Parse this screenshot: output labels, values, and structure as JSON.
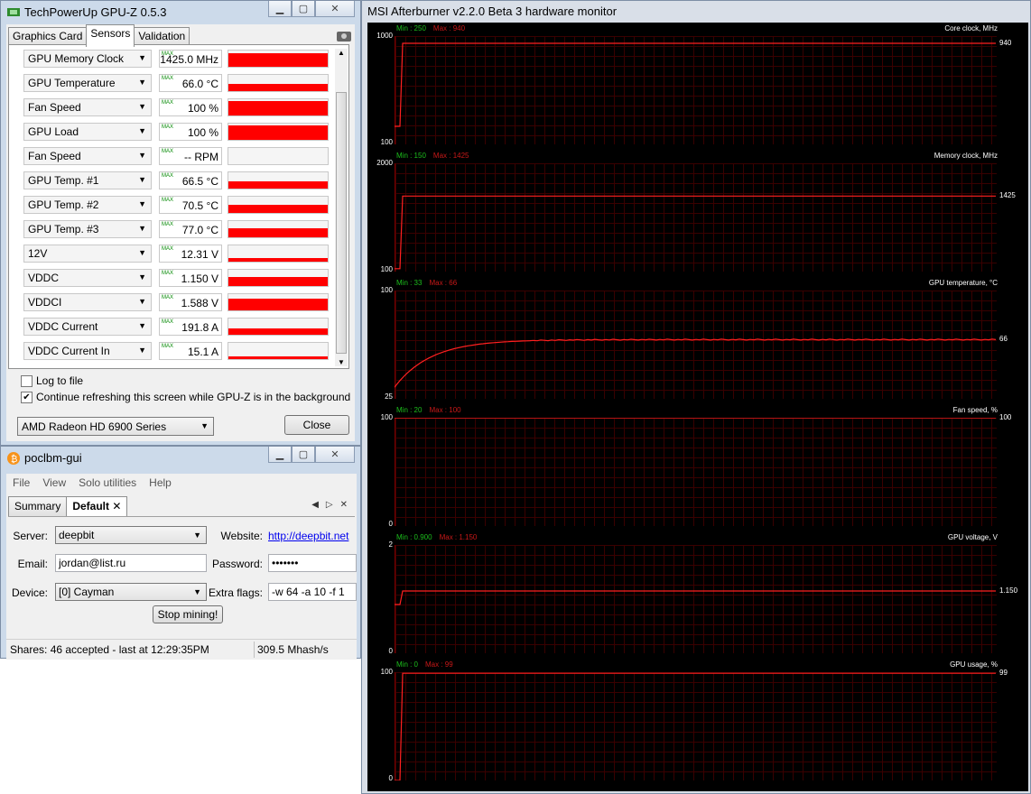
{
  "gpuz": {
    "title": "TechPowerUp GPU-Z 0.5.3",
    "tabs": [
      "Graphics Card",
      "Sensors",
      "Validation"
    ],
    "sensors": [
      {
        "name": "GPU Memory Clock",
        "value": "1425.0 MHz",
        "level": 0.95
      },
      {
        "name": "GPU Temperature",
        "value": "66.0 °C",
        "level": 0.5
      },
      {
        "name": "Fan Speed",
        "value": "100 %",
        "level": 1.0
      },
      {
        "name": "GPU Load",
        "value": "100 %",
        "level": 1.0
      },
      {
        "name": "Fan Speed",
        "value": "-- RPM",
        "level": 0
      },
      {
        "name": "GPU Temp. #1",
        "value": "66.5 °C",
        "level": 0.5
      },
      {
        "name": "GPU Temp. #2",
        "value": "70.5 °C",
        "level": 0.55
      },
      {
        "name": "GPU Temp. #3",
        "value": "77.0 °C",
        "level": 0.65
      },
      {
        "name": "12V",
        "value": "12.31 V",
        "level": 0.25
      },
      {
        "name": "VDDC",
        "value": "1.150 V",
        "level": 0.6
      },
      {
        "name": "VDDCI",
        "value": "1.588 V",
        "level": 0.8
      },
      {
        "name": "VDDC Current",
        "value": "191.8 A",
        "level": 0.45
      },
      {
        "name": "VDDC Current In",
        "value": "15.1 A",
        "level": 0.2
      }
    ],
    "max_label": "MAX",
    "log_to_file": "Log to file",
    "continue_refresh": "Continue refreshing this screen while GPU-Z is in the background",
    "log_checked": false,
    "refresh_checked": true,
    "card_select": "AMD Radeon HD 6900 Series",
    "close_label": "Close"
  },
  "poclbm": {
    "title": "poclbm-gui",
    "menu": [
      "File",
      "View",
      "Solo utilities",
      "Help"
    ],
    "tabs": [
      "Summary",
      "Default"
    ],
    "server_label": "Server:",
    "server_value": "deepbit",
    "website_label": "Website:",
    "website_value": "http://deepbit.net",
    "email_label": "Email:",
    "email_value": "jordan@list.ru",
    "password_label": "Password:",
    "password_value": "•••••••",
    "device_label": "Device:",
    "device_value": "[0] Cayman",
    "flags_label": "Extra flags:",
    "flags_value": "-w 64 -a 10 -f 1",
    "stop_label": "Stop mining!",
    "status_shares": "Shares: 46 accepted - last at 12:29:35PM",
    "status_rate": "309.5 Mhash/s"
  },
  "afterburner": {
    "title": "MSI Afterburner v2.2.0 Beta 3 hardware monitor",
    "graphs": [
      {
        "name": "Core clock, MHz",
        "min_label": "Min : 250",
        "max_label": "Max : 940",
        "ymax": "1000",
        "ymin": "100",
        "current": "940",
        "lo": 100,
        "hi": 1000,
        "start": 250,
        "value": 940,
        "shape": "step"
      },
      {
        "name": "Memory clock, MHz",
        "min_label": "Min : 150",
        "max_label": "Max : 1425",
        "ymax": "2000",
        "ymin": "100",
        "current": "1425",
        "lo": 100,
        "hi": 2000,
        "start": 150,
        "value": 1425,
        "shape": "step"
      },
      {
        "name": "GPU temperature, °C",
        "min_label": "Min : 33",
        "max_label": "Max : 66",
        "ymax": "100",
        "ymin": "25",
        "current": "66",
        "lo": 25,
        "hi": 100,
        "start": 33,
        "value": 66,
        "shape": "curve"
      },
      {
        "name": "Fan speed, %",
        "min_label": "Min : 20",
        "max_label": "Max : 100",
        "ymax": "100",
        "ymin": "0",
        "current": "100",
        "lo": 0,
        "hi": 100,
        "start": 100,
        "value": 100,
        "shape": "flat"
      },
      {
        "name": "GPU voltage, V",
        "min_label": "Min : 0.900",
        "max_label": "Max : 1.150",
        "ymax": "2",
        "ymin": "0",
        "current": "1.150",
        "lo": 0,
        "hi": 2,
        "start": 0.9,
        "value": 1.15,
        "shape": "step"
      },
      {
        "name": "GPU usage, %",
        "min_label": "Min : 0",
        "max_label": "Max : 99",
        "ymax": "100",
        "ymin": "0",
        "current": "99",
        "lo": 0,
        "hi": 100,
        "start": 0,
        "value": 99,
        "shape": "step"
      }
    ]
  }
}
